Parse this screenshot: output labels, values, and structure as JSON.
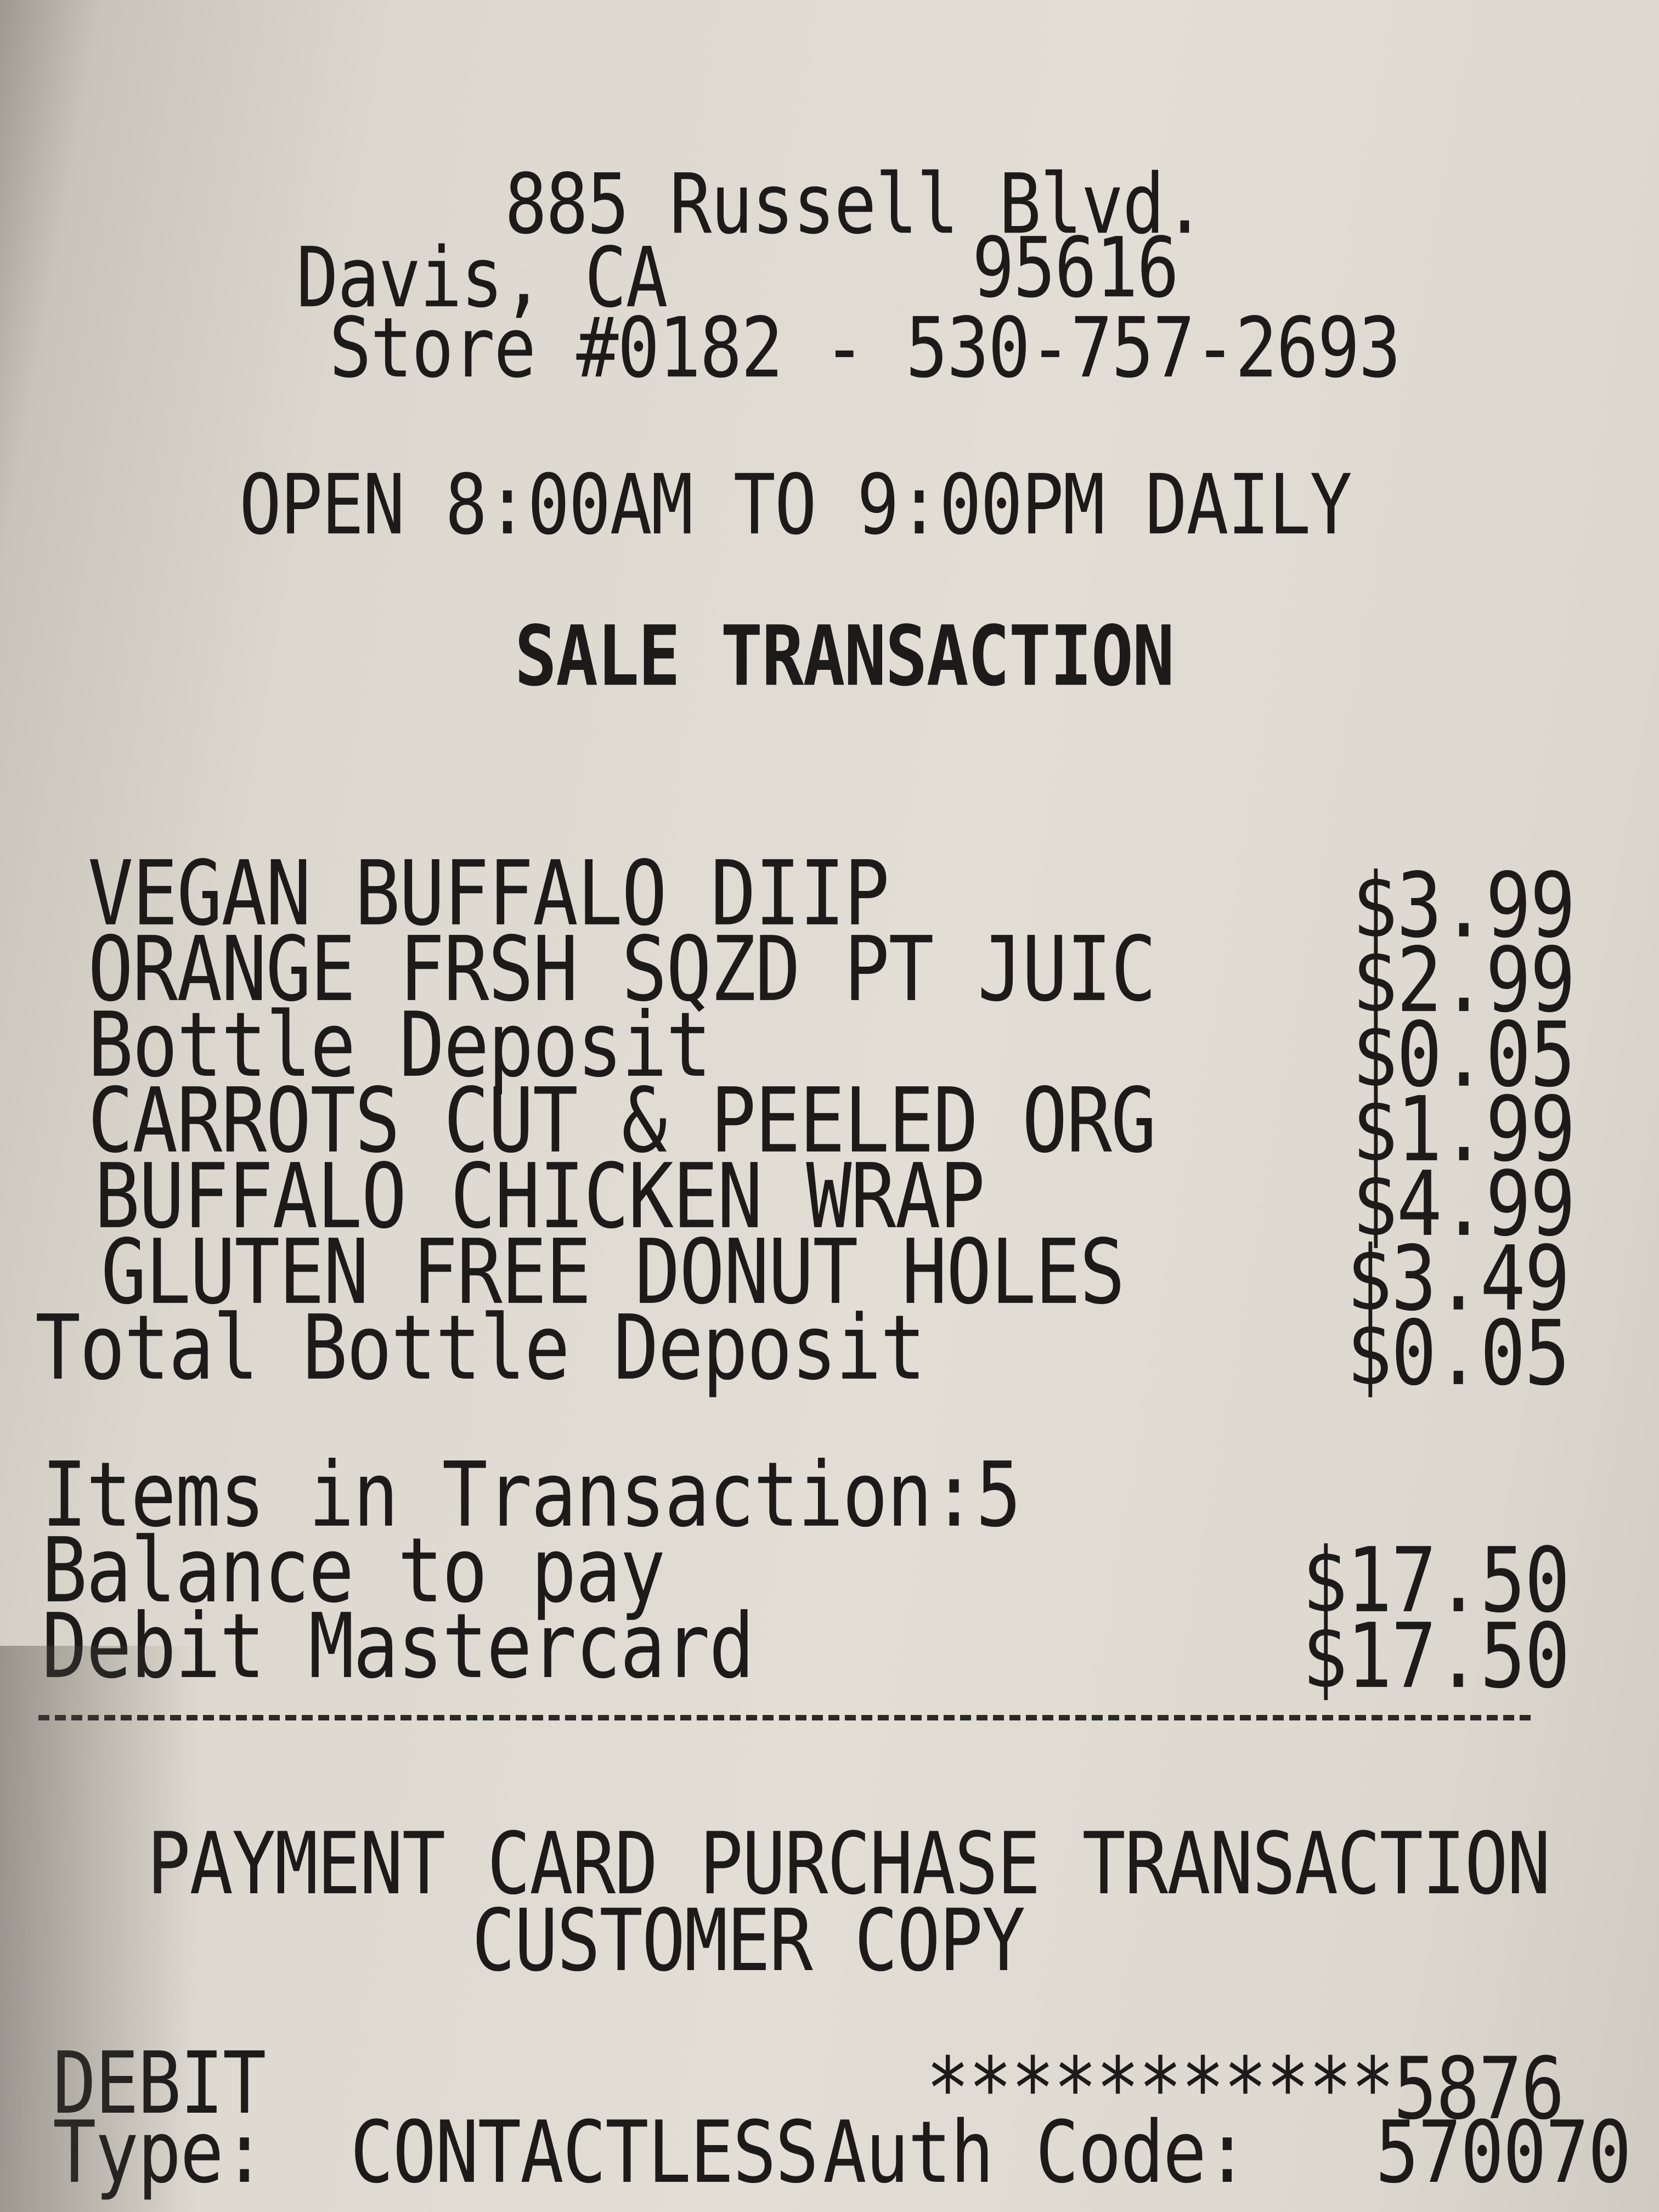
{
  "store": {
    "address_line1": "885 Russell Blvd.",
    "city_state": "Davis, CA",
    "zip": "95616",
    "store_phone": "Store #0182 - 530-757-2693",
    "hours": "OPEN 8:00AM TO 9:00PM DAILY"
  },
  "transaction_title": "SALE TRANSACTION",
  "items": [
    {
      "name": "VEGAN BUFFALO DIIP",
      "price": "$3.99"
    },
    {
      "name": "ORANGE FRSH SQZD PT JUIC",
      "price": "$2.99"
    },
    {
      "name": "Bottle Deposit",
      "price": "$0.05"
    },
    {
      "name": "CARROTS CUT & PEELED ORG",
      "price": "$1.99"
    },
    {
      "name": "BUFFALO CHICKEN WRAP",
      "price": "$4.99"
    },
    {
      "name": "GLUTEN FREE DONUT HOLES",
      "price": "$3.49"
    }
  ],
  "total_bottle_deposit": {
    "label": "Total Bottle Deposit",
    "value": "$0.05"
  },
  "items_count": "Items in Transaction:5",
  "balance": {
    "label": "Balance to pay",
    "value": "$17.50"
  },
  "payment": {
    "label": "Debit Mastercard",
    "value": "$17.50"
  },
  "card_section": {
    "title": "PAYMENT CARD PURCHASE TRANSACTION",
    "subtitle": "CUSTOMER COPY",
    "card_type": "DEBIT",
    "card_number": "***********5876",
    "entry_type": "Type:  CONTACTLESS",
    "auth_code": "Auth Code:   570070"
  }
}
